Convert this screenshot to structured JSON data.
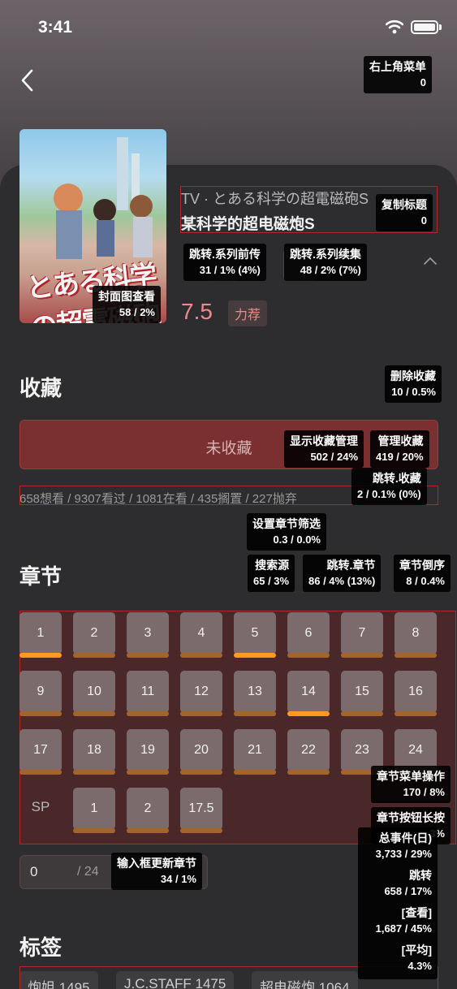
{
  "status": {
    "time": "3:41"
  },
  "subject": {
    "title_jp": "TV · とある科学の超電磁砲S",
    "title_cn": "某科学的超电磁炮S",
    "cover_text": "とある科学の超電磁砲",
    "score": "7.5",
    "rank_label": "力荐"
  },
  "collection": {
    "section_title": "收藏",
    "button_label": "未收藏",
    "stats": "658想看 / 9307看过 / 1081在看 / 435搁置 / 227抛弃"
  },
  "episodes": {
    "section_title": "章节",
    "main": [
      "1",
      "2",
      "3",
      "4",
      "5",
      "6",
      "7",
      "8",
      "9",
      "10",
      "11",
      "12",
      "13",
      "14",
      "15",
      "16",
      "17",
      "18",
      "19",
      "20",
      "21",
      "22",
      "23",
      "24"
    ],
    "watched": [
      "1",
      "5",
      "14"
    ],
    "sp_label": "SP",
    "sp": [
      "1",
      "2",
      "17.5"
    ],
    "input_value": "0",
    "input_total": "/ 24"
  },
  "tags": {
    "section_title": "标签",
    "items": [
      "炮姐 1495",
      "J.C.STAFF 1475",
      "超电磁炮 1064"
    ]
  },
  "overlays": [
    {
      "id": "top-right-menu",
      "label": "右上角菜单",
      "value": "0"
    },
    {
      "id": "copy-title",
      "label": "复制标题",
      "value": "0"
    },
    {
      "id": "series-prev",
      "label": "跳转.系列前传",
      "value": "31 / 1% (4%)"
    },
    {
      "id": "series-next",
      "label": "跳转.系列续集",
      "value": "48 / 2% (7%)"
    },
    {
      "id": "cover-view",
      "label": "封面图查看",
      "value": "58 / 2%"
    },
    {
      "id": "delete-collection",
      "label": "删除收藏",
      "value": "10 / 0.5%"
    },
    {
      "id": "show-collection-manage",
      "label": "显示收藏管理",
      "value": "502 / 24%"
    },
    {
      "id": "manage-collection",
      "label": "管理收藏",
      "value": "419 / 20%"
    },
    {
      "id": "goto-collection",
      "label": "跳转.收藏",
      "value": "2 / 0.1% (0%)"
    },
    {
      "id": "episode-filter",
      "label": "设置章节筛选",
      "value": "0.3 / 0.0%"
    },
    {
      "id": "search-source",
      "label": "搜索源",
      "value": "65 / 3%"
    },
    {
      "id": "goto-episode",
      "label": "跳转.章节",
      "value": "86 / 4% (13%)"
    },
    {
      "id": "episode-reverse",
      "label": "章节倒序",
      "value": "8 / 0.4%"
    },
    {
      "id": "episode-menu",
      "label": "章节菜单操作",
      "value": "170 / 8%"
    },
    {
      "id": "episode-longpress",
      "label": "章节按钮长按",
      "value": "3%"
    },
    {
      "id": "input-update",
      "label": "输入框更新章节",
      "value": "34 / 1%"
    }
  ],
  "summary": {
    "total_label": "总事件(日)",
    "total_value": "3,733 / 29%",
    "jump_label": "跳转",
    "jump_value": "658 / 17%",
    "view_label": "[查看]",
    "view_value": "1,687 / 45%",
    "avg_label": "[平均]",
    "avg_value": "4.3%"
  }
}
